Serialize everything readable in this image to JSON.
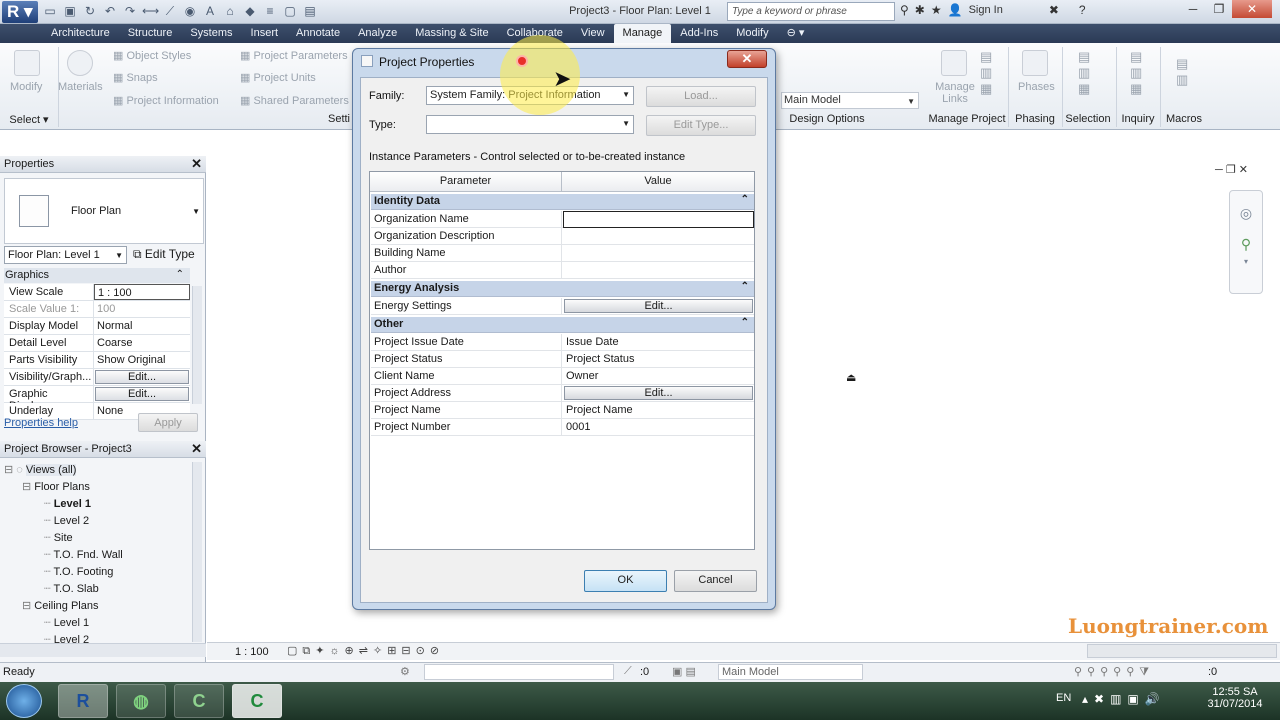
{
  "app": {
    "title": "Project3 - Floor Plan: Level 1",
    "search_placeholder": "Type a keyword or phrase",
    "sign_in": "Sign In",
    "logo_letter": "R"
  },
  "tabs": [
    "Architecture",
    "Structure",
    "Systems",
    "Insert",
    "Annotate",
    "Analyze",
    "Massing & Site",
    "Collaborate",
    "View",
    "Manage",
    "Add-Ins",
    "Modify"
  ],
  "active_tab": "Manage",
  "ribbon": {
    "modify": "Modify",
    "materials": "Materials",
    "object_styles": "Object Styles",
    "snaps": "Snaps",
    "project_information": "Project Information",
    "project_parameters": "Project Parameters",
    "project_units": "Project Units",
    "shared_parameters": "Shared Parameters",
    "manage_links": "Manage Links",
    "phases": "Phases",
    "main_model": "Main Model",
    "panels": {
      "select": "Select",
      "settings": "Setti",
      "design_options": "Design Options",
      "manage_project": "Manage Project",
      "phasing": "Phasing",
      "selection": "Selection",
      "inquiry": "Inquiry",
      "macros": "Macros"
    }
  },
  "properties": {
    "header": "Properties",
    "type_name": "Floor Plan",
    "type_selector": "Floor Plan: Level 1",
    "edit_type": "Edit Type",
    "section": "Graphics",
    "rows": [
      {
        "k": "View Scale",
        "v": "1 : 100"
      },
      {
        "k": "Scale Value 1:",
        "v": "100"
      },
      {
        "k": "Display Model",
        "v": "Normal"
      },
      {
        "k": "Detail Level",
        "v": "Coarse"
      },
      {
        "k": "Parts Visibility",
        "v": "Show Original"
      },
      {
        "k": "Visibility/Graph...",
        "v": "Edit..."
      },
      {
        "k": "Graphic Displa...",
        "v": "Edit..."
      },
      {
        "k": "Underlay",
        "v": "None"
      }
    ],
    "help": "Properties help",
    "apply": "Apply"
  },
  "browser": {
    "header": "Project Browser - Project3",
    "items": [
      {
        "label": "Views (all)"
      },
      {
        "label": "Floor Plans"
      },
      {
        "label": "Level 1"
      },
      {
        "label": "Level 2"
      },
      {
        "label": "Site"
      },
      {
        "label": "T.O. Fnd. Wall"
      },
      {
        "label": "T.O. Footing"
      },
      {
        "label": "T.O. Slab"
      },
      {
        "label": "Ceiling Plans"
      },
      {
        "label": "Level 1"
      },
      {
        "label": "Level 2"
      }
    ]
  },
  "dialog": {
    "title": "Project Properties",
    "family_label": "Family:",
    "family_value": "System Family: Project Information",
    "load": "Load...",
    "type_label": "Type:",
    "type_value": "",
    "edit_type": "Edit Type...",
    "instance_caption": "Instance Parameters - Control selected or to-be-created instance",
    "col_parameter": "Parameter",
    "col_value": "Value",
    "sections": [
      {
        "name": "Identity Data",
        "rows": [
          {
            "p": "Organization Name",
            "v": ""
          },
          {
            "p": "Organization Description",
            "v": ""
          },
          {
            "p": "Building Name",
            "v": ""
          },
          {
            "p": "Author",
            "v": ""
          }
        ]
      },
      {
        "name": "Energy Analysis",
        "rows": [
          {
            "p": "Energy Settings",
            "v": "Edit..."
          }
        ]
      },
      {
        "name": "Other",
        "rows": [
          {
            "p": "Project Issue Date",
            "v": "Issue Date"
          },
          {
            "p": "Project Status",
            "v": "Project Status"
          },
          {
            "p": "Client Name",
            "v": "Owner"
          },
          {
            "p": "Project Address",
            "v": "Edit..."
          },
          {
            "p": "Project Name",
            "v": "Project Name"
          },
          {
            "p": "Project Number",
            "v": "0001"
          }
        ]
      }
    ],
    "ok": "OK",
    "cancel": "Cancel"
  },
  "status": {
    "ready": "Ready",
    "scale": "1 : 100",
    "main_model": "Main Model",
    "count": ":0"
  },
  "taskbar": {
    "lang": "EN",
    "time": "12:55 SA",
    "date": "31/07/2014"
  },
  "watermark": "Luongtrainer.com"
}
